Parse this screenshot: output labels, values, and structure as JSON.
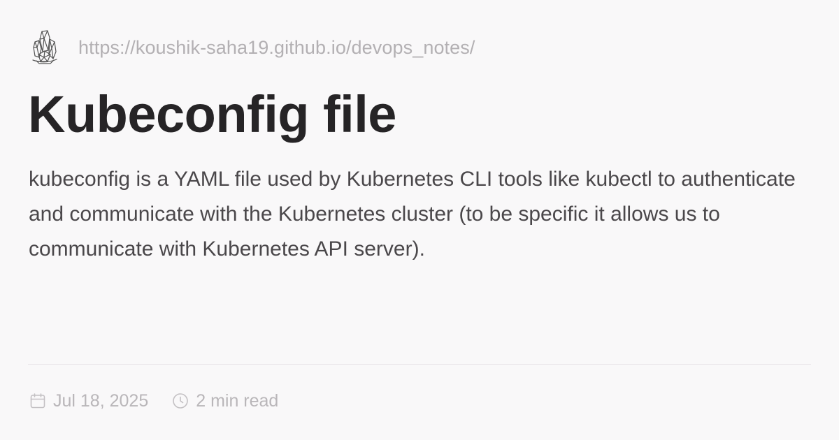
{
  "site": {
    "logo_icon": "crystal-logo-icon",
    "url": "https://koushik-saha19.github.io/devops_notes/"
  },
  "article": {
    "title": "Kubeconfig file",
    "description": "kubeconfig is a YAML file used by Kubernetes CLI tools like kubectl to authenticate and communicate with the Kubernetes cluster (to be specific it allows us to communicate with Kubernetes API server)."
  },
  "meta": {
    "date_icon": "calendar-icon",
    "date": "Jul 18, 2025",
    "read_time_icon": "clock-icon",
    "read_time": "2 min read"
  },
  "colors": {
    "background": "#f9f8f9",
    "title": "#262426",
    "description": "#4a474a",
    "muted": "#b3b0b3",
    "divider": "#e6e3e6"
  }
}
